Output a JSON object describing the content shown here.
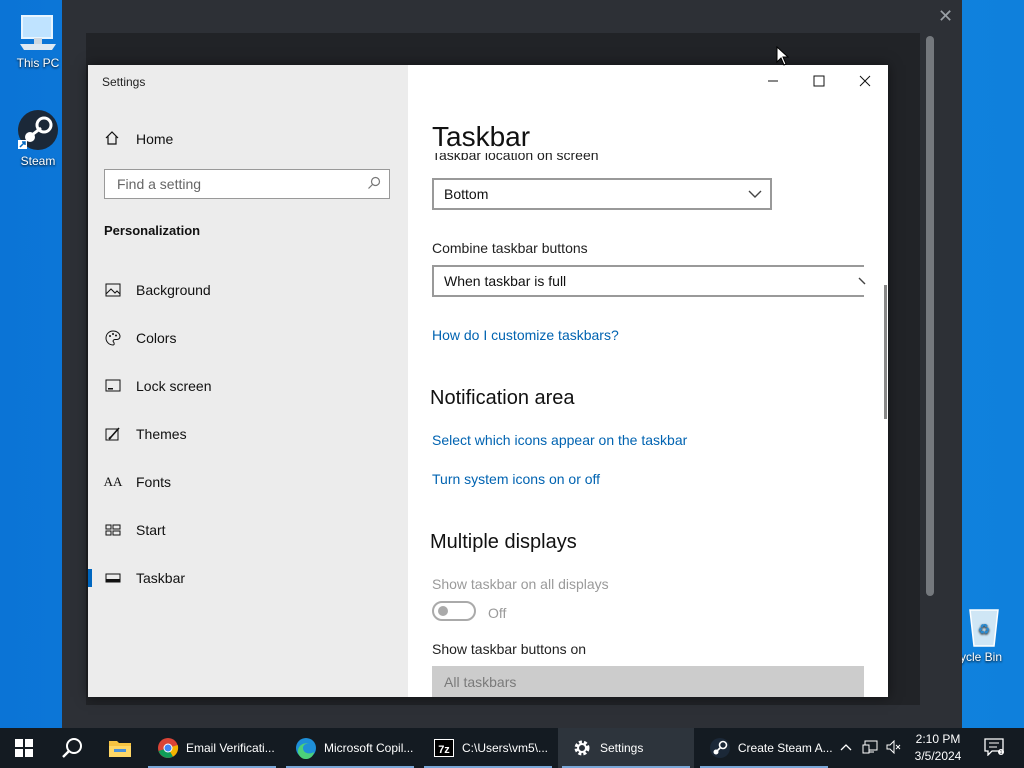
{
  "desktop": {
    "icons": [
      {
        "label": "This PC",
        "icon": "computer-icon"
      },
      {
        "label": "Steam",
        "icon": "steam-icon"
      },
      {
        "label": "ycle Bin",
        "icon": "recycle-bin-icon"
      }
    ]
  },
  "settings": {
    "app_title": "Settings",
    "home_label": "Home",
    "search_placeholder": "Find a setting",
    "section": "Personalization",
    "nav": [
      {
        "label": "Background",
        "icon": "picture-icon"
      },
      {
        "label": "Colors",
        "icon": "palette-icon"
      },
      {
        "label": "Lock screen",
        "icon": "lock-screen-icon"
      },
      {
        "label": "Themes",
        "icon": "brush-icon"
      },
      {
        "label": "Fonts",
        "icon": "fonts-icon"
      },
      {
        "label": "Start",
        "icon": "start-icon"
      },
      {
        "label": "Taskbar",
        "icon": "taskbar-icon",
        "active": true
      }
    ],
    "page_title": "Taskbar",
    "location_label": "Taskbar location on screen",
    "location_value": "Bottom",
    "combine_label": "Combine taskbar buttons",
    "combine_value": "When taskbar is full",
    "customize_link": "How do I customize taskbars?",
    "notification_title": "Notification area",
    "notif_link_1": "Select which icons appear on the taskbar",
    "notif_link_2": "Turn system icons on or off",
    "multiple_title": "Multiple displays",
    "show_all_label": "Show taskbar on all displays",
    "toggle_state": "Off",
    "show_buttons_label": "Show taskbar buttons on",
    "show_buttons_value": "All taskbars"
  },
  "taskbar": {
    "apps": [
      {
        "label": "Email Verificati...",
        "icon": "chrome-icon"
      },
      {
        "label": "Microsoft Copil...",
        "icon": "edge-icon"
      },
      {
        "label": "C:\\Users\\vm5\\...",
        "icon": "7zip-icon"
      },
      {
        "label": "Settings",
        "icon": "settings-gear-icon"
      },
      {
        "label": "Create Steam A...",
        "icon": "steam-icon"
      }
    ],
    "time": "2:10 PM",
    "date": "3/5/2024"
  }
}
